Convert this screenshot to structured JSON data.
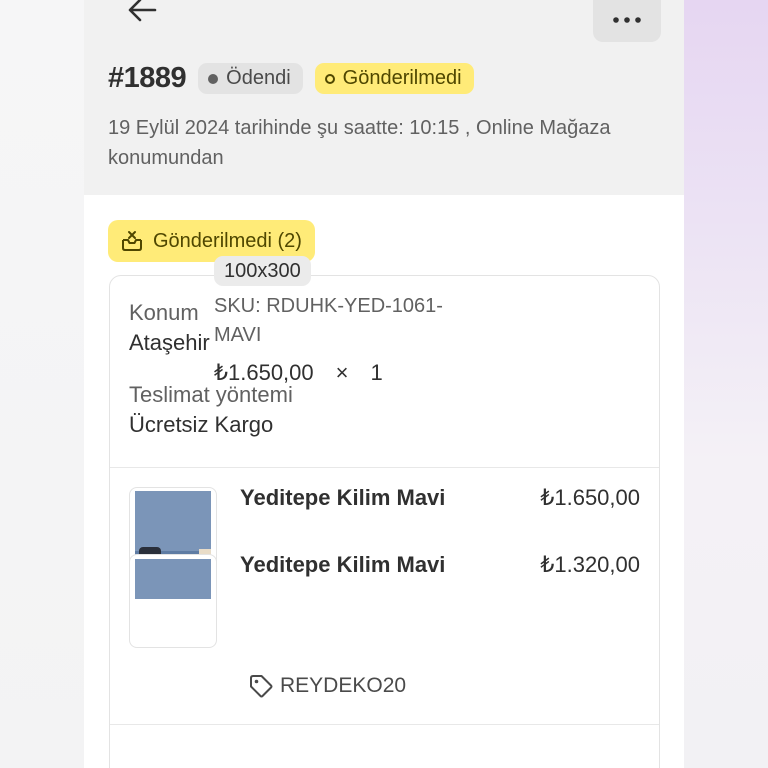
{
  "header": {
    "order_number": "#1889",
    "payment_status": "Ödendi",
    "fulfillment_status": "Gönderilmedi",
    "meta_text": "19 Eylül 2024 tarihinde şu saatte: 10:15 , Online Mağaza konumundan"
  },
  "fulfillment": {
    "badge_label": "Gönderilmedi (2)",
    "location_label": "Konum",
    "location_value": "Ataşehir",
    "delivery_label": "Teslimat yöntemi",
    "delivery_value": "Ücretsiz Kargo"
  },
  "items": [
    {
      "title": "Yeditepe Kilim Mavi",
      "price_total": "₺1.650,00",
      "variant": "100x300",
      "sku": "SKU: RDUHK-YED-1061-MAVI",
      "unit_price": "₺1.650,00",
      "times": "×",
      "quantity": "1",
      "discount_code": "REYDEKO20"
    },
    {
      "title": "Yeditepe Kilim Mavi",
      "price_total": "₺1.320,00"
    }
  ],
  "icons": {
    "back": "arrow-left-icon",
    "more": "more-horizontal-icon",
    "fulfillment": "box-unfulfilled-icon",
    "discount": "tag-icon"
  },
  "colors": {
    "warning_badge_bg": "#ffeb78",
    "neutral_badge_bg": "#e3e3e3",
    "header_bg": "#f1f1f1"
  }
}
